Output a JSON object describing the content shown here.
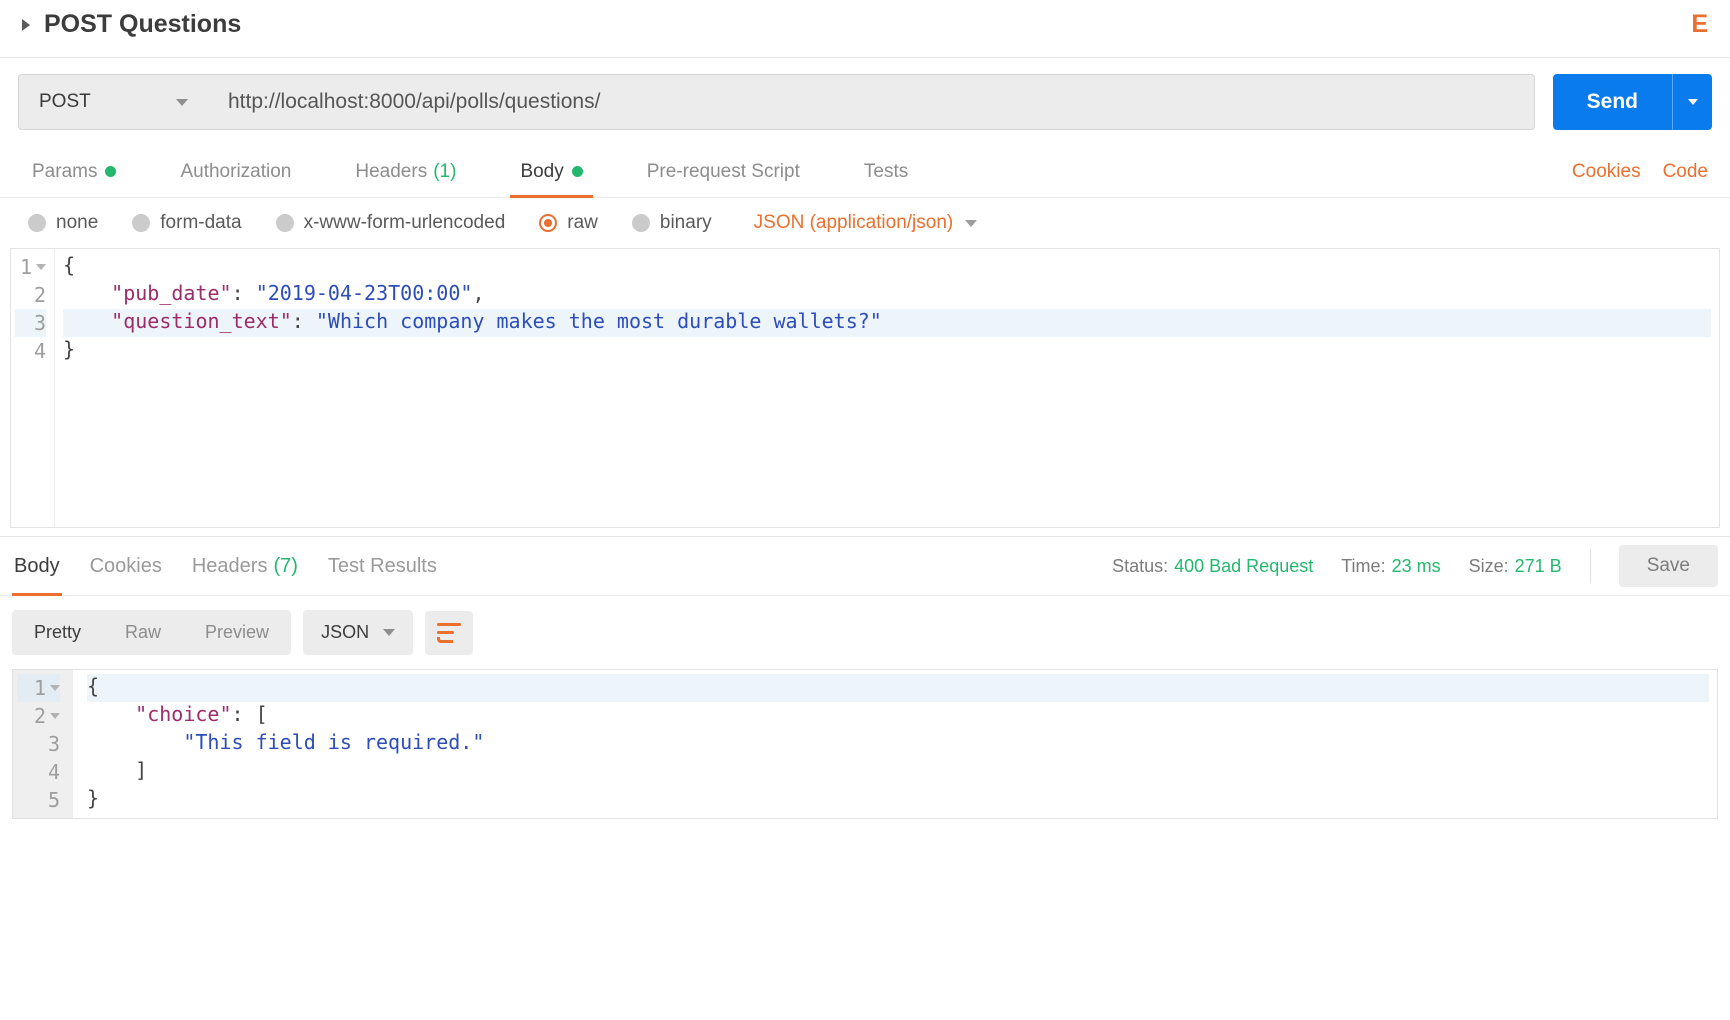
{
  "header": {
    "breadcrumb": "POST Questions",
    "right_cutoff": "E"
  },
  "request": {
    "method": "POST",
    "url": "http://localhost:8000/api/polls/questions/",
    "send_label": "Send"
  },
  "req_tabs": {
    "params": "Params",
    "auth": "Authorization",
    "headers": "Headers",
    "headers_count": "(1)",
    "body": "Body",
    "pre": "Pre-request Script",
    "tests": "Tests"
  },
  "req_right": {
    "cookies": "Cookies",
    "code": "Code"
  },
  "body_types": {
    "none": "none",
    "form_data": "form-data",
    "xform": "x-www-form-urlencoded",
    "raw": "raw",
    "binary": "binary",
    "content_type": "JSON (application/json)"
  },
  "request_body": {
    "line1": "{",
    "line2_key": "\"pub_date\"",
    "line2_val": "\"2019-04-23T00:00\"",
    "line3_key": "\"question_text\"",
    "line3_val": "\"Which company makes the most durable wallets?\"",
    "line4": "}"
  },
  "resp_tabs": {
    "body": "Body",
    "cookies": "Cookies",
    "headers": "Headers",
    "headers_count": "(7)",
    "tests": "Test Results"
  },
  "resp_meta": {
    "status_label": "Status:",
    "status_value": "400 Bad Request",
    "time_label": "Time:",
    "time_value": "23 ms",
    "size_label": "Size:",
    "size_value": "271 B",
    "save": "Save"
  },
  "view": {
    "pretty": "Pretty",
    "raw": "Raw",
    "preview": "Preview",
    "format": "JSON"
  },
  "response_body": {
    "l1": "{",
    "l2_key": "\"choice\"",
    "l2_rest": ": [",
    "l3": "\"This field is required.\"",
    "l4": "]",
    "l5": "}"
  }
}
